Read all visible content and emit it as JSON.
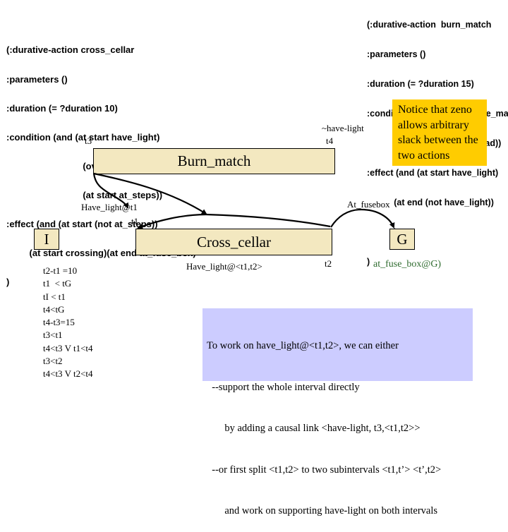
{
  "burn_match_pddl": [
    "(:durative-action  burn_match",
    ":parameters ()",
    ":duration (= ?duration 15)",
    ":condition: (and (at start have_match)",
    "            (at start have_strikepad))",
    ":effect (and (at start have_light)",
    "           (at end (not have_light))",
    "           )",
    ")"
  ],
  "cross_cellar_pddl": [
    "(:durative-action cross_cellar",
    ":parameters ()",
    ":duration (= ?duration 10)",
    ":condition (and (at start have_light)",
    "                              (over all have_light)",
    "                              (at start at_steps))",
    ":effect (and (at start (not at_steps))",
    "         (at start crossing)(at end at_fuse_box)",
    ")"
  ],
  "diagram": {
    "burn_match": {
      "label": "Burn_match",
      "start_label": "t3",
      "end_label": "t4",
      "end_effect": "~have-light"
    },
    "cross_cellar": {
      "label": "Cross_cellar",
      "start_label": "t1",
      "end_label": "t2",
      "condition": "Have_light@<t1,t2>"
    },
    "init_step": {
      "label": "I"
    },
    "goal_step": {
      "label": "G",
      "goal": "at_fuse_box@G)"
    },
    "links": {
      "have_light_t1": "Have_light@t1",
      "at_fusebox": "At_fusebox"
    }
  },
  "note": {
    "text": "Notice that zeno allows arbitrary slack between the two actions",
    "color": "#ffcc00"
  },
  "constraints": [
    "t2-t1 =10",
    "t1  < tG",
    "tI < t1",
    "t4<tG",
    "t4-t3=15",
    "t3<t1",
    "t4<t3 V t1<t4",
    "t3<t2",
    "t4<t3 V t2<t4"
  ],
  "explanation": {
    "lines": [
      "To work on have_light@<t1,t2>, we can either",
      "  --support the whole interval directly",
      "       by adding a causal link <have-light, t3,<t1,t2>>",
      "  --or first split <t1,t2> to two subintervals <t1,t’> <t’,t2>",
      "       and work on supporting have-light on both intervals"
    ],
    "color": "#ccccff"
  },
  "colors": {
    "step_fill": "#f3e8c0",
    "goal_text": "#2e6b2e"
  }
}
